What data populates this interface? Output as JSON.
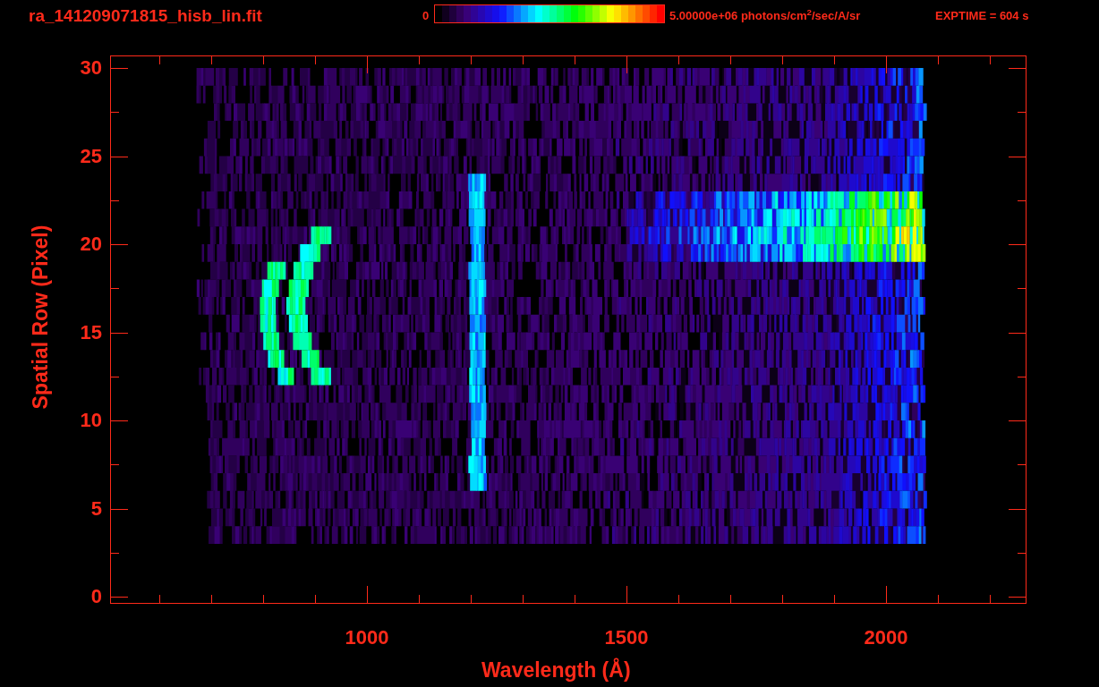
{
  "plot": {
    "title": "ra_141209071815_hisb_lin.fit",
    "colorbar": {
      "min_label": "0",
      "max_label": "5.00000e+06 photons/cm$^{2}$/sec/A/sr"
    },
    "exposure": "EXPTIME = 604 s",
    "y_axis": {
      "label": "Spatial Row (Pixel)",
      "ticks": [
        "30",
        "25",
        "20",
        "15",
        "10",
        "5",
        "0"
      ]
    },
    "x_axis": {
      "label": "Wavelength (Å)",
      "ticks": [
        "1000",
        "1500",
        "2000"
      ]
    }
  }
}
